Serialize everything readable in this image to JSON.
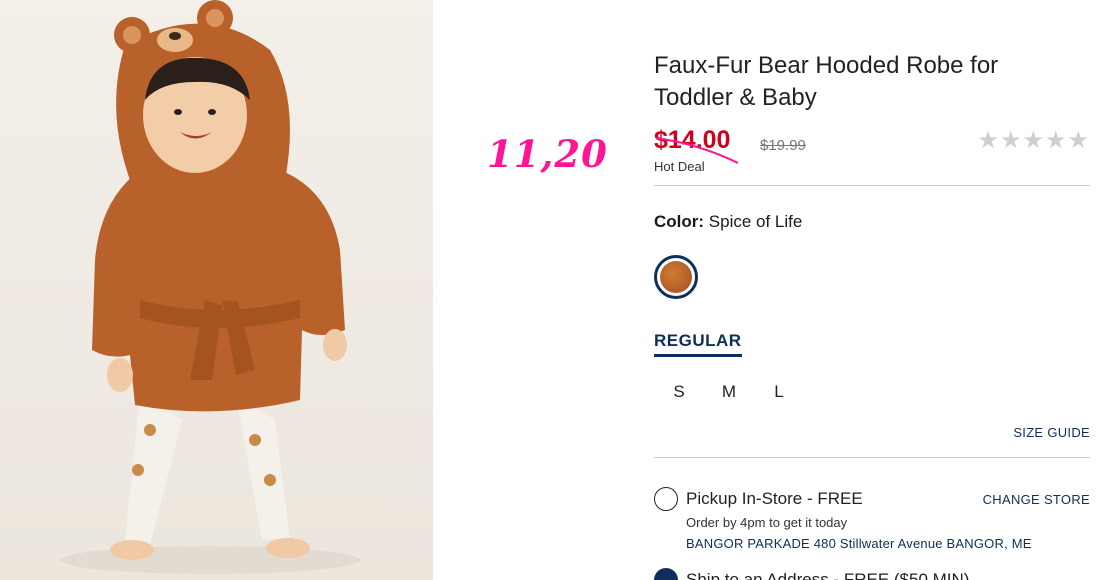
{
  "product": {
    "title": "Faux-Fur Bear Hooded Robe for Toddler & Baby",
    "sale_price": "$14.00",
    "original_price": "$19.99",
    "deal_label": "Hot Deal",
    "rating_stars": "★★★★★",
    "rating_value": 0
  },
  "annotation": {
    "handwritten_price": "11,20",
    "color": "#ff1493"
  },
  "color": {
    "label": "Color:",
    "value": "Spice of Life",
    "swatch_color": "#b9612a"
  },
  "fit": {
    "selected": "REGULAR"
  },
  "sizes": [
    "S",
    "M",
    "L"
  ],
  "size_guide": "SIZE GUIDE",
  "fulfillment": {
    "pickup_label": "Pickup In-Store - FREE",
    "change_store": "CHANGE STORE",
    "order_by": "Order by 4pm to get it today",
    "store_address": "BANGOR PARKADE 480 Stillwater Avenue  BANGOR, ME",
    "ship_label": "Ship to an Address - FREE ($50 MIN)"
  },
  "colors": {
    "sale": "#d0021b",
    "navy": "#0f2e5a",
    "stars": "#cfcfcf"
  }
}
